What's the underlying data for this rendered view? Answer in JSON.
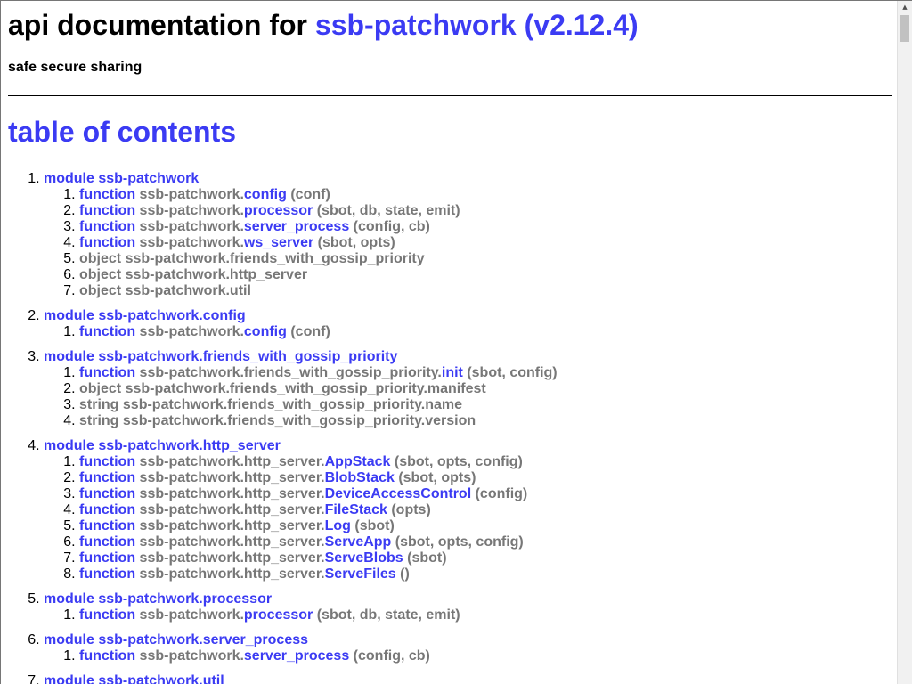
{
  "header": {
    "title_prefix": "api documentation for ",
    "package_name": "ssb-patchwork (v2.12.4)",
    "tagline": "safe secure sharing"
  },
  "toc": {
    "heading": "table of contents",
    "modules": [
      {
        "label": "module ssb-patchwork",
        "members": [
          {
            "kind": "function",
            "ns": "ssb-patchwork.",
            "name": "config",
            "args": " (conf)"
          },
          {
            "kind": "function",
            "ns": "ssb-patchwork.",
            "name": "processor",
            "args": " (sbot, db, state, emit)"
          },
          {
            "kind": "function",
            "ns": "ssb-patchwork.",
            "name": "server_process",
            "args": " (config, cb)"
          },
          {
            "kind": "function",
            "ns": "ssb-patchwork.",
            "name": "ws_server",
            "args": " (sbot, opts)"
          },
          {
            "kind": "other",
            "text": "object ssb-patchwork.friends_with_gossip_priority"
          },
          {
            "kind": "other",
            "text": "object ssb-patchwork.http_server"
          },
          {
            "kind": "other",
            "text": "object ssb-patchwork.util"
          }
        ]
      },
      {
        "label": "module ssb-patchwork.config",
        "members": [
          {
            "kind": "function",
            "ns": "ssb-patchwork.",
            "name": "config",
            "args": " (conf)"
          }
        ]
      },
      {
        "label": "module ssb-patchwork.friends_with_gossip_priority",
        "members": [
          {
            "kind": "function",
            "ns": "ssb-patchwork.friends_with_gossip_priority.",
            "name": "init",
            "args": " (sbot, config)"
          },
          {
            "kind": "other",
            "text": "object ssb-patchwork.friends_with_gossip_priority.manifest"
          },
          {
            "kind": "other",
            "text": "string ssb-patchwork.friends_with_gossip_priority.name"
          },
          {
            "kind": "other",
            "text": "string ssb-patchwork.friends_with_gossip_priority.version"
          }
        ]
      },
      {
        "label": "module ssb-patchwork.http_server",
        "members": [
          {
            "kind": "function",
            "ns": "ssb-patchwork.http_server.",
            "name": "AppStack",
            "args": " (sbot, opts, config)"
          },
          {
            "kind": "function",
            "ns": "ssb-patchwork.http_server.",
            "name": "BlobStack",
            "args": " (sbot, opts)"
          },
          {
            "kind": "function",
            "ns": "ssb-patchwork.http_server.",
            "name": "DeviceAccessControl",
            "args": " (config)"
          },
          {
            "kind": "function",
            "ns": "ssb-patchwork.http_server.",
            "name": "FileStack",
            "args": " (opts)"
          },
          {
            "kind": "function",
            "ns": "ssb-patchwork.http_server.",
            "name": "Log",
            "args": " (sbot)"
          },
          {
            "kind": "function",
            "ns": "ssb-patchwork.http_server.",
            "name": "ServeApp",
            "args": " (sbot, opts, config)"
          },
          {
            "kind": "function",
            "ns": "ssb-patchwork.http_server.",
            "name": "ServeBlobs",
            "args": " (sbot)"
          },
          {
            "kind": "function",
            "ns": "ssb-patchwork.http_server.",
            "name": "ServeFiles",
            "args": " ()"
          }
        ]
      },
      {
        "label": "module ssb-patchwork.processor",
        "members": [
          {
            "kind": "function",
            "ns": "ssb-patchwork.",
            "name": "processor",
            "args": " (sbot, db, state, emit)"
          }
        ]
      },
      {
        "label": "module ssb-patchwork.server_process",
        "members": [
          {
            "kind": "function",
            "ns": "ssb-patchwork.",
            "name": "server_process",
            "args": " (config, cb)"
          }
        ]
      },
      {
        "label": "module ssb-patchwork.util",
        "members": []
      }
    ]
  },
  "scrollbar": {
    "up_arrow_icon": "triangle-up-icon",
    "up_arrow_glyph": "▲"
  },
  "colors": {
    "link": "#3b3bf3",
    "muted": "#777777"
  }
}
